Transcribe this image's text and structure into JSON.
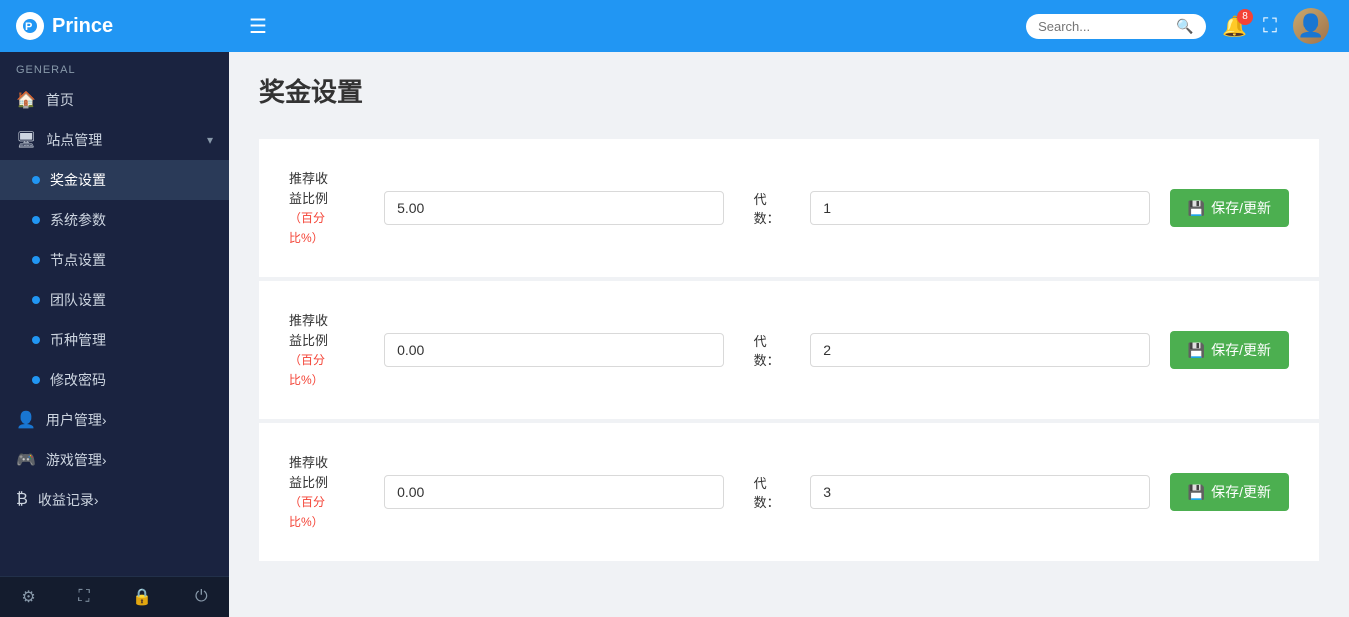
{
  "app": {
    "name": "Prince"
  },
  "sidebar": {
    "section_label": "GENERAL",
    "items": [
      {
        "key": "home",
        "label": "首页",
        "icon": "🏠",
        "type": "nav",
        "dot": false
      },
      {
        "key": "site-management",
        "label": "站点管理",
        "icon": "🖥",
        "type": "parent",
        "dot": false,
        "expanded": true
      },
      {
        "key": "bonus-settings",
        "label": "奖金设置",
        "type": "sub",
        "dot": true,
        "active": true
      },
      {
        "key": "system-params",
        "label": "系统参数",
        "type": "sub",
        "dot": true,
        "active": false
      },
      {
        "key": "node-settings",
        "label": "节点设置",
        "type": "sub",
        "dot": true,
        "active": false
      },
      {
        "key": "team-settings",
        "label": "团队设置",
        "type": "sub",
        "dot": true,
        "active": false
      },
      {
        "key": "coin-management",
        "label": "币种管理",
        "type": "sub",
        "dot": true,
        "active": false
      },
      {
        "key": "change-password",
        "label": "修改密码",
        "type": "sub",
        "dot": true,
        "active": false
      },
      {
        "key": "user-management",
        "label": "用户管理›",
        "icon": "👤",
        "type": "nav",
        "dot": false
      },
      {
        "key": "game-management",
        "label": "游戏管理›",
        "icon": "🎮",
        "type": "nav",
        "dot": false
      },
      {
        "key": "income-records",
        "label": "收益记录›",
        "icon": "₿",
        "type": "nav",
        "dot": false
      }
    ],
    "footer_icons": [
      "⚙",
      "⛶",
      "🔒",
      "⏻"
    ]
  },
  "topbar": {
    "search_placeholder": "Search...",
    "notification_count": "8"
  },
  "page": {
    "title": "奖金设置",
    "rows": [
      {
        "label_line1": "推荐收",
        "label_line2": "益比例",
        "label_note": "（百分\n比%）",
        "ratio_value": "5.00",
        "dai_shu_label": "代数：",
        "dai_shu_value": "1",
        "save_label": "保存/更新"
      },
      {
        "label_line1": "推荐收",
        "label_line2": "益比例",
        "label_note": "（百分\n比%）",
        "ratio_value": "0.00",
        "dai_shu_label": "代数：",
        "dai_shu_value": "2",
        "save_label": "保存/更新"
      },
      {
        "label_line1": "推荐收",
        "label_line2": "益比例",
        "label_note": "（百分\n比%）",
        "ratio_value": "0.00",
        "dai_shu_label": "代数：",
        "dai_shu_value": "3",
        "save_label": "保存/更新"
      }
    ]
  }
}
